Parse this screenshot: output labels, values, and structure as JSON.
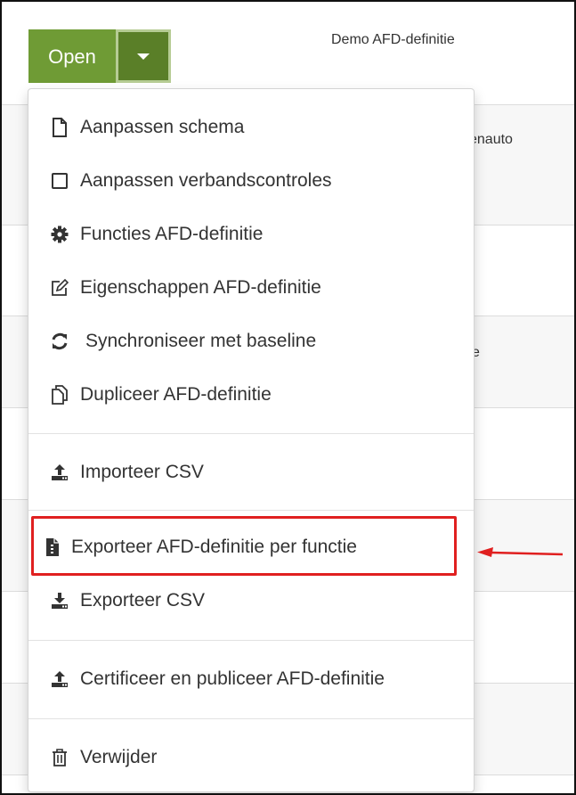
{
  "header": {
    "title": "Demo AFD-definitie",
    "open_label": "Open"
  },
  "background": {
    "row_texts": [
      "enauto",
      "e"
    ]
  },
  "menu": {
    "items": [
      {
        "label": "Aanpassen schema",
        "icon": "file-icon"
      },
      {
        "label": "Aanpassen verbandscontroles",
        "icon": "square-icon"
      },
      {
        "label": "Functies AFD-definitie",
        "icon": "gear-icon"
      },
      {
        "label": "Eigenschappen AFD-definitie",
        "icon": "edit-icon"
      },
      {
        "label": "Synchroniseer met baseline",
        "icon": "sync-icon"
      },
      {
        "label": "Dupliceer AFD-definitie",
        "icon": "copy-icon"
      },
      {
        "label": "Importeer CSV",
        "icon": "upload-icon"
      },
      {
        "label": "Exporteer AFD-definitie per functie",
        "icon": "file-export-icon"
      },
      {
        "label": "Exporteer CSV",
        "icon": "download-icon"
      },
      {
        "label": "Certificeer en publiceer AFD-definitie",
        "icon": "upload-icon"
      },
      {
        "label": "Verwijder",
        "icon": "trash-icon"
      }
    ]
  },
  "colors": {
    "button_green": "#6f9b35",
    "caret_green": "#5a7f28",
    "highlight_red": "#e02020"
  }
}
